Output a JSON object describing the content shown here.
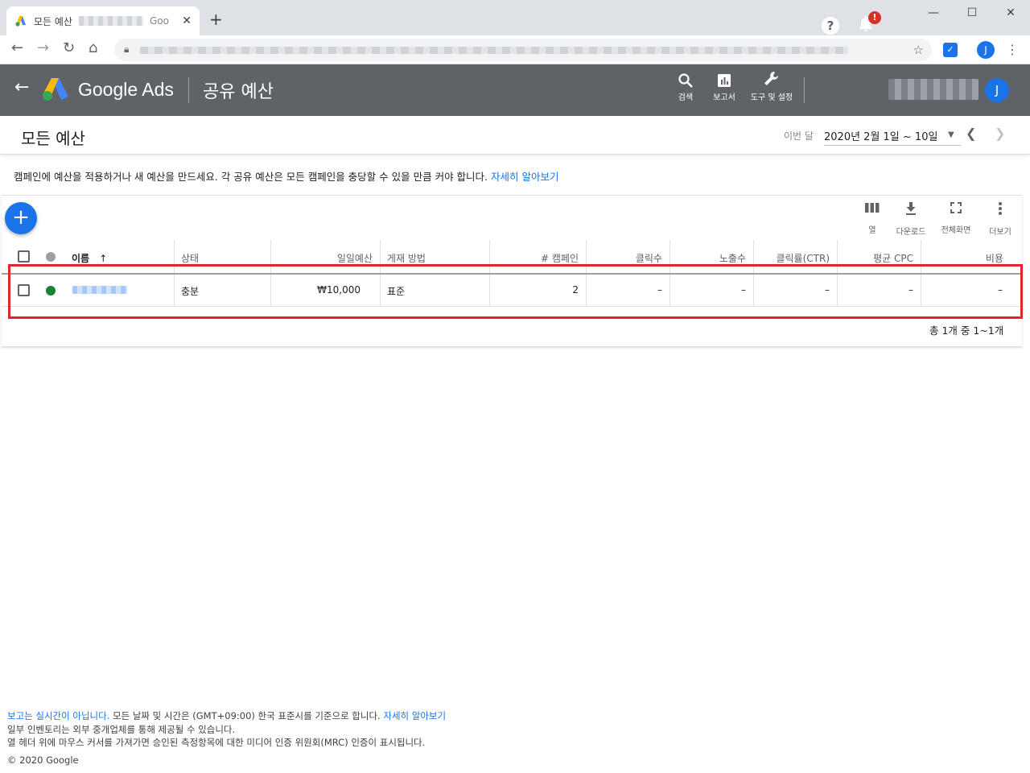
{
  "browser": {
    "tab_title": "모든 예산",
    "tab_title_suffix": "Goo",
    "tab_close": "✕",
    "new_tab": "+",
    "window_controls": [
      "—",
      "☐",
      "✕"
    ],
    "profile_initial": "J"
  },
  "header": {
    "brand": "Google Ads",
    "page_heading": "공유 예산",
    "tools": [
      {
        "icon": "search-icon",
        "label": "검색"
      },
      {
        "icon": "reports-icon",
        "label": "보고서"
      },
      {
        "icon": "wrench-icon",
        "label": "도구 및 설정"
      }
    ],
    "notification_badge": "!",
    "avatar_initial": "J",
    "colors": {
      "bar": "#5f6368",
      "accent": "#1a73e8",
      "alert": "#d93025"
    }
  },
  "title_bar": {
    "title": "모든 예산",
    "date_label": "이번 달",
    "date_value": "2020년 2월 1일 ~ 10일"
  },
  "info": {
    "text": "캠페인에 예산을 적용하거나 새 예산을 만드세요. 각 공유 예산은 모든 캠페인을 충당할 수 있을 만큼 커야 합니다. ",
    "link": "자세히 알아보기"
  },
  "table_tools": [
    {
      "icon": "columns-icon",
      "label": "열"
    },
    {
      "icon": "download-icon",
      "label": "다운로드"
    },
    {
      "icon": "fullscreen-icon",
      "label": "전체화면"
    },
    {
      "icon": "more-vert-icon",
      "label": "더보기"
    }
  ],
  "table": {
    "columns": [
      "이름",
      "상태",
      "일일예산",
      "게재 방법",
      "# 캠페인",
      "클릭수",
      "노출수",
      "클릭률(CTR)",
      "평균 CPC",
      "비용"
    ],
    "sort_indicator": "↑",
    "rows": [
      {
        "status_color": "#188038",
        "status": "충분",
        "daily_budget": "₩10,000",
        "delivery": "표준",
        "campaigns": "2",
        "clicks": "–",
        "impressions": "–",
        "ctr": "–",
        "avg_cpc": "–",
        "cost": "–"
      }
    ],
    "pagination": "총 1개 중 1~1개"
  },
  "footer": {
    "line1_link": "보고는 실시간이 아닙니다.",
    "line1_text": " 모든 날짜 및 시간은 (GMT+09:00) 한국 표준시를 기준으로 합니다. ",
    "line1_link2": "자세히 알아보기",
    "line2": "일부 인벤토리는 외부 중개업체를 통해 제공될 수 있습니다.",
    "line3": "열 헤더 위에 마우스 커서를 가져가면 승인된 측정항목에 대한 미디어 인증 위원회(MRC) 인증이 표시됩니다.",
    "copyright": "© 2020 Google"
  }
}
